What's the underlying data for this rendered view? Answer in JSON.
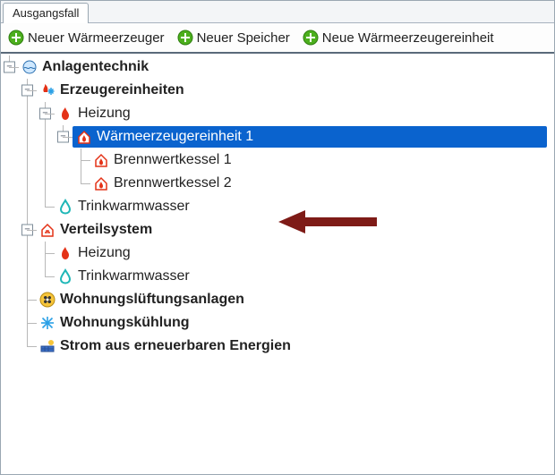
{
  "tabs": [
    {
      "label": "Ausgangsfall"
    }
  ],
  "toolbar": {
    "new_generator": "Neuer Wärmeerzeuger",
    "new_storage": "Neuer Speicher",
    "new_generator_unit": "Neue Wärmeerzeugereinheit"
  },
  "tree": {
    "root": {
      "label": "Anlagentechnik"
    },
    "erzeugereinheiten": {
      "label": "Erzeugereinheiten"
    },
    "heizung_gen": {
      "label": "Heizung"
    },
    "unit1": {
      "label": "Wärmeerzeugereinheit 1"
    },
    "bk1": {
      "label": "Brennwertkessel 1"
    },
    "bk2": {
      "label": "Brennwertkessel 2"
    },
    "tww_gen": {
      "label": "Trinkwarmwasser"
    },
    "verteilsystem": {
      "label": "Verteilsystem"
    },
    "heizung_dist": {
      "label": "Heizung"
    },
    "tww_dist": {
      "label": "Trinkwarmwasser"
    },
    "wohnungslueftung": {
      "label": "Wohnungslüftungsanlagen"
    },
    "wohnungskuehlung": {
      "label": "Wohnungskühlung"
    },
    "ee_strom": {
      "label": "Strom aus erneuerbaren Energien"
    }
  },
  "glyphs": {
    "minus": "−",
    "plus": "+"
  }
}
